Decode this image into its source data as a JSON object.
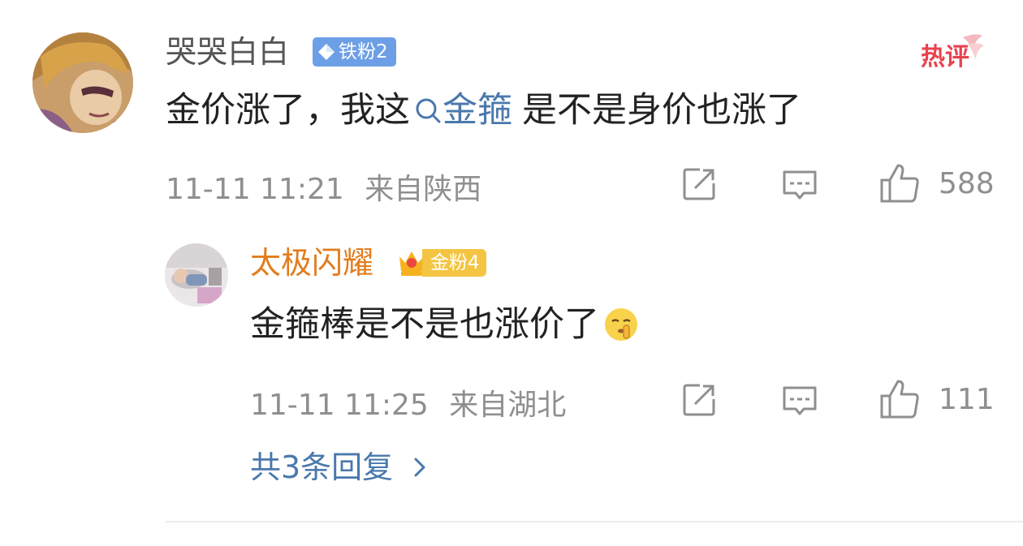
{
  "comment": {
    "username": "哭哭白白",
    "fan_badge": "铁粉2",
    "hot_label": "热评",
    "text_before": "金价涨了，我这",
    "link_text": "金箍",
    "text_after": "是不是身价也涨了",
    "timestamp": "11-11 11:21",
    "location": "来自陕西",
    "like_count": "588"
  },
  "reply": {
    "username": "太极闪耀",
    "fan_badge": "金粉4",
    "text": "金箍棒是不是也涨价了",
    "emoji": "shushing-face-emoji",
    "timestamp": "11-11 11:25",
    "location": "来自湖北",
    "like_count": "111"
  },
  "more_replies": "共3条回复",
  "colors": {
    "link": "#4a78ad",
    "reply_username": "#e37d1e",
    "meta": "#8f8f8f",
    "iron_badge": "#6d9fe6",
    "gold_badge": "#f4c542",
    "hot": "#e8434e"
  }
}
